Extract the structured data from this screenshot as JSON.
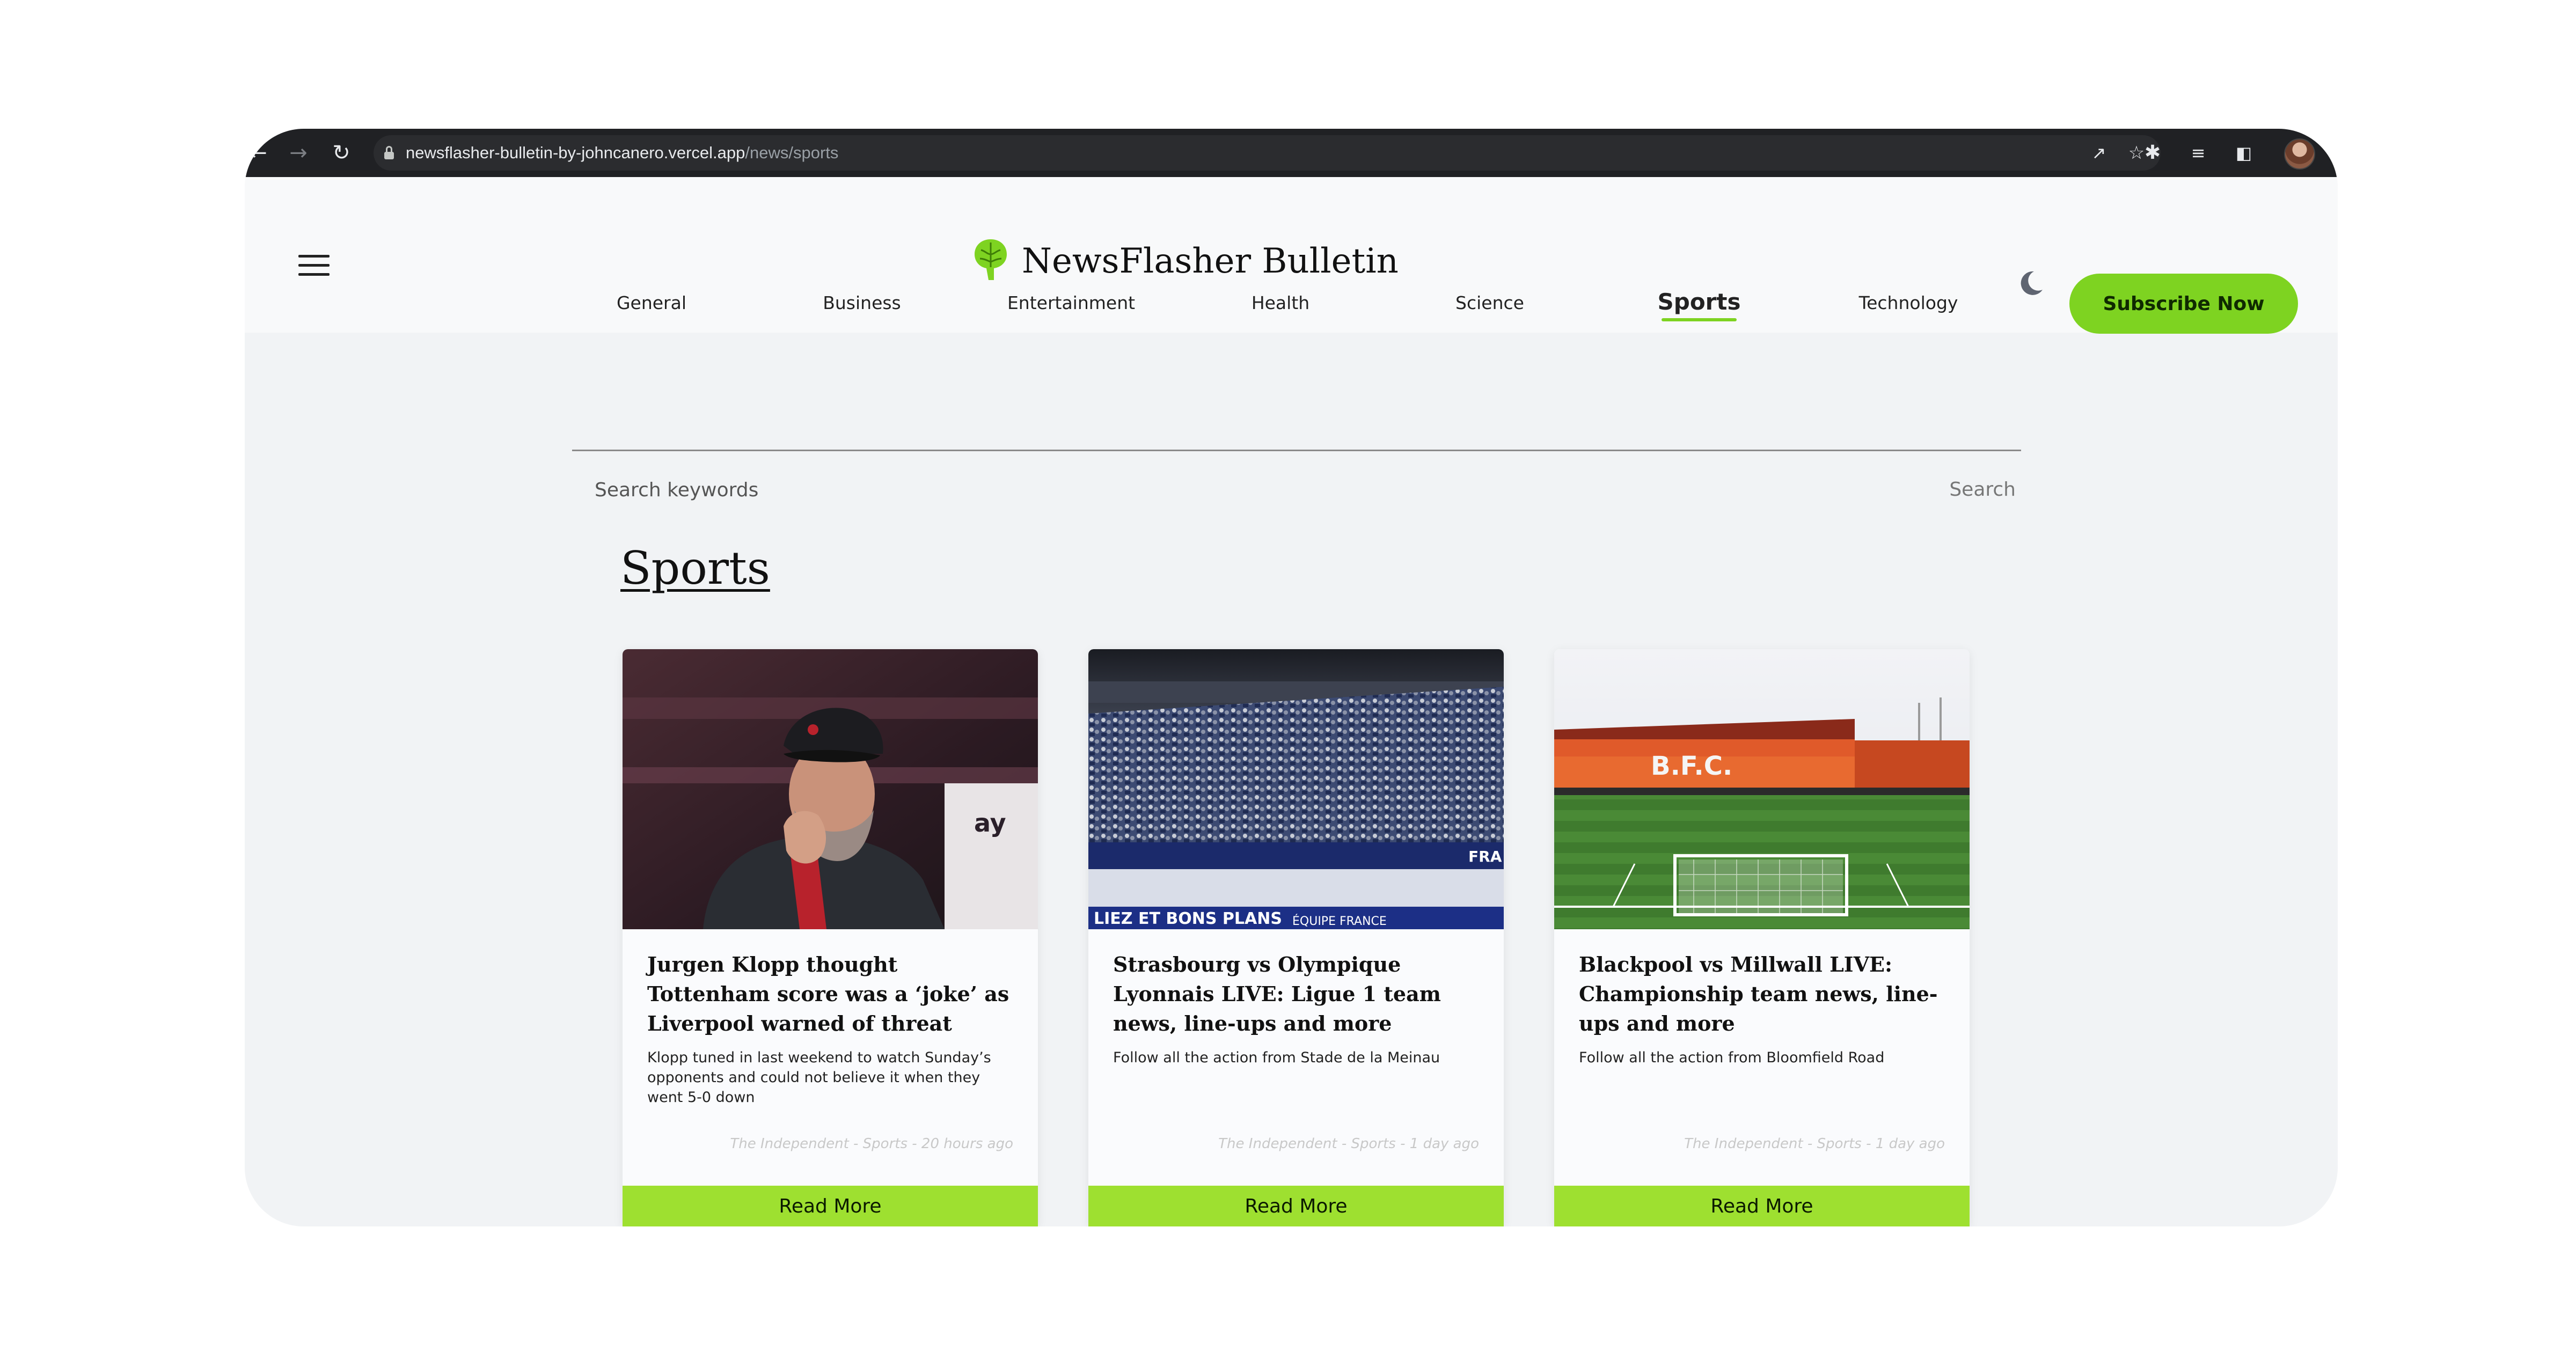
{
  "browser": {
    "url_host": "newsflasher-bulletin-by-johncanero.vercel.app",
    "url_path": "/news/sports"
  },
  "header": {
    "site_title": "NewsFlasher Bulletin",
    "subscribe_label": "Subscribe Now"
  },
  "categories": [
    {
      "label": "General",
      "active": false
    },
    {
      "label": "Business",
      "active": false
    },
    {
      "label": "Entertainment",
      "active": false
    },
    {
      "label": "Health",
      "active": false
    },
    {
      "label": "Science",
      "active": false
    },
    {
      "label": "Sports",
      "active": true
    },
    {
      "label": "Technology",
      "active": false
    }
  ],
  "search": {
    "placeholder": "Search keywords",
    "button_label": "Search"
  },
  "page_heading": "Sports",
  "articles": [
    {
      "title": "Jurgen Klopp thought Tottenham score was a ‘joke’ as Liverpool warned of threat",
      "description": "Klopp tuned in last weekend to watch Sunday’s opponents and could not believe it when they went 5-0 down",
      "meta": "The Independent - Sports - 20 hours ago",
      "cta": "Read More"
    },
    {
      "title": "Strasbourg vs Olympique Lyonnais LIVE: Ligue 1 team news, line-ups and more",
      "description": "Follow all the action from Stade de la Meinau",
      "meta": "The Independent - Sports - 1 day ago",
      "cta": "Read More"
    },
    {
      "title": "Blackpool vs Millwall LIVE: Championship team news, line-ups and more",
      "description": "Follow all the action from Bloomfield Road",
      "meta": "The Independent - Sports - 1 day ago",
      "cta": "Read More"
    }
  ],
  "image_text": {
    "stadium_letters": "B.F.C.",
    "banner_left": "LIEZ ET BONS PLANS",
    "banner_mid": "ÉQUIPE FRANCE",
    "banner_right": "FRA",
    "board_text": "ay"
  },
  "colors": {
    "accent": "#7ed321",
    "read_more": "#9ee030",
    "chrome": "#202124"
  }
}
